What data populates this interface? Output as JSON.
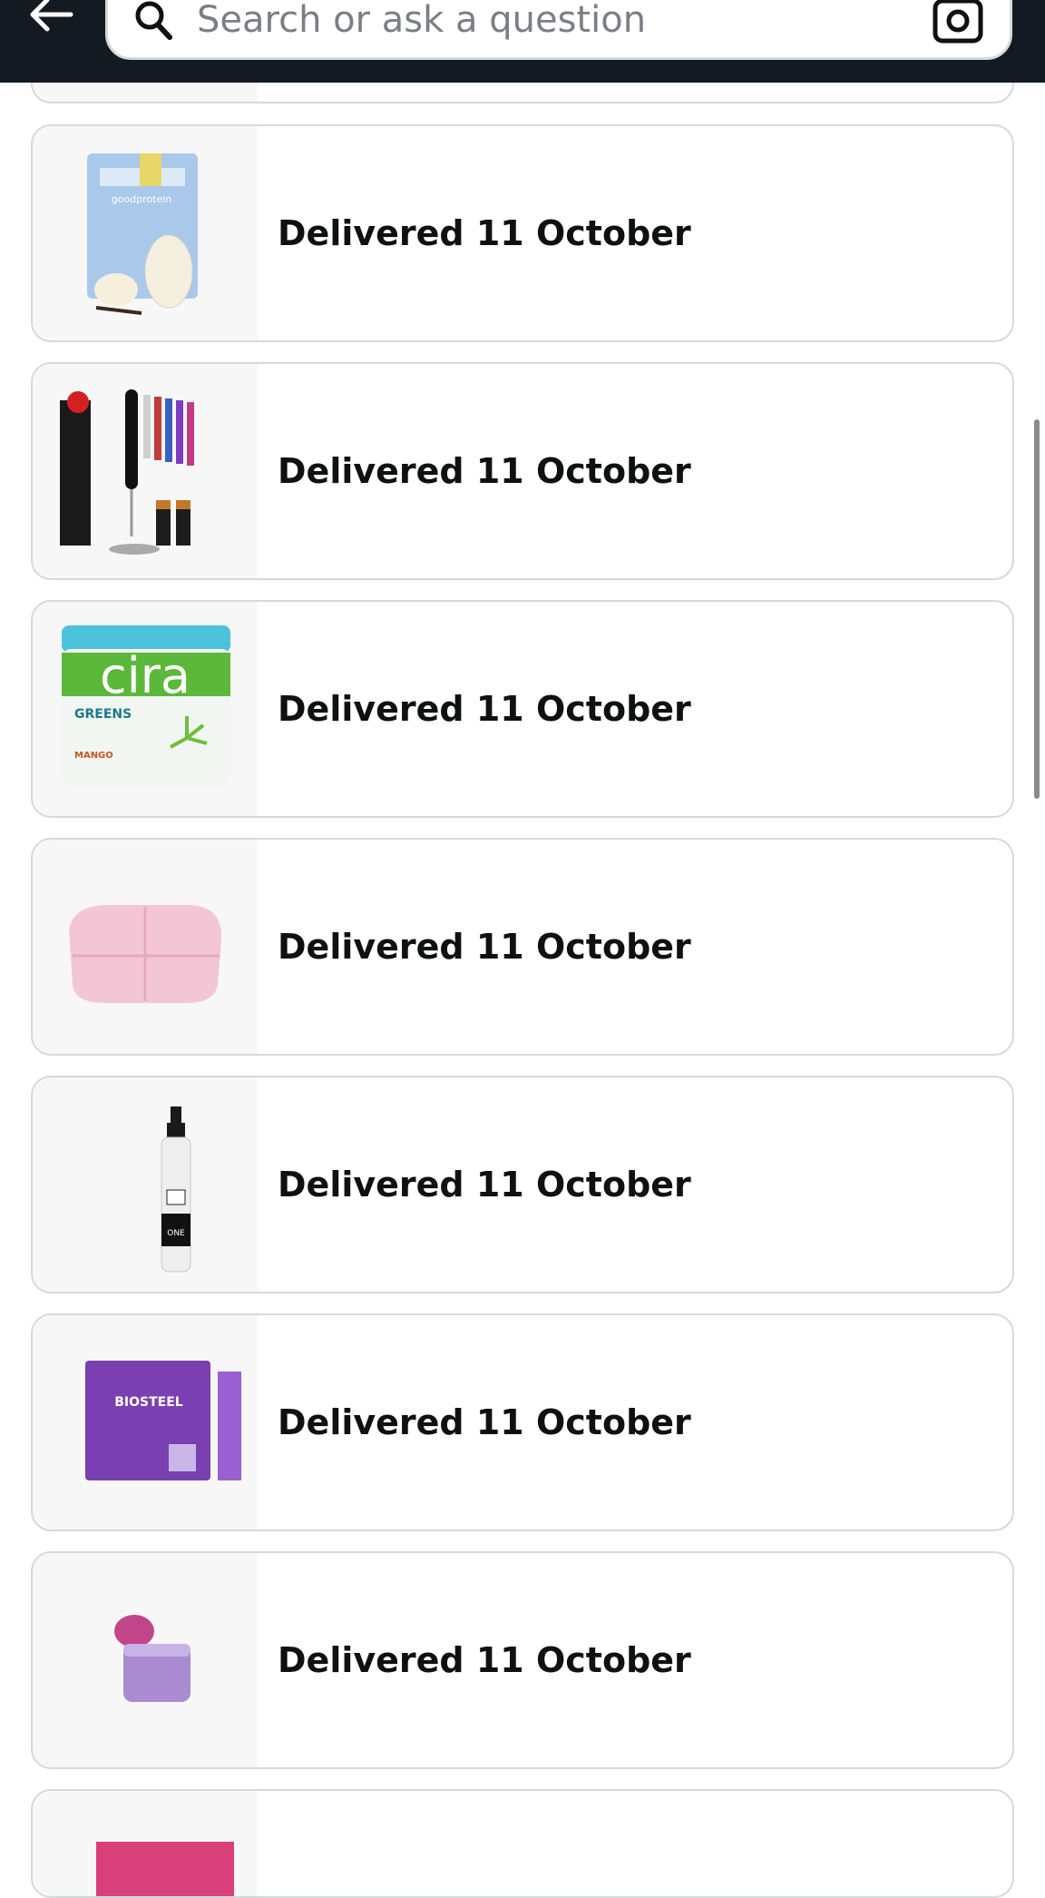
{
  "header": {
    "search": {
      "placeholder": "Search or ask a question"
    },
    "icons": {
      "back": "arrow-left-icon",
      "search": "search-icon",
      "camera": "camera-lens-icon"
    }
  },
  "orders": [
    {
      "status": "Delivered 11 October",
      "product_image": "goodprotein-powder-bag"
    },
    {
      "status": "Delivered 11 October",
      "product_image": "milk-frother-set"
    },
    {
      "status": "Delivered 11 October",
      "product_image": "cira-greens-superfood-powder"
    },
    {
      "status": "Delivered 11 October",
      "product_image": "pink-puffy-pouch"
    },
    {
      "status": "Delivered 11 October",
      "product_image": "redken-one-united-spray"
    },
    {
      "status": "Delivered 11 October",
      "product_image": "biosteel-hydration-mix"
    },
    {
      "status": "Delivered 11 October",
      "product_image": "laneige-lip-sleeping-mask"
    }
  ],
  "colors": {
    "header_bg": "#131a22",
    "card_border": "#d5d9d9",
    "text": "#0f1111"
  }
}
